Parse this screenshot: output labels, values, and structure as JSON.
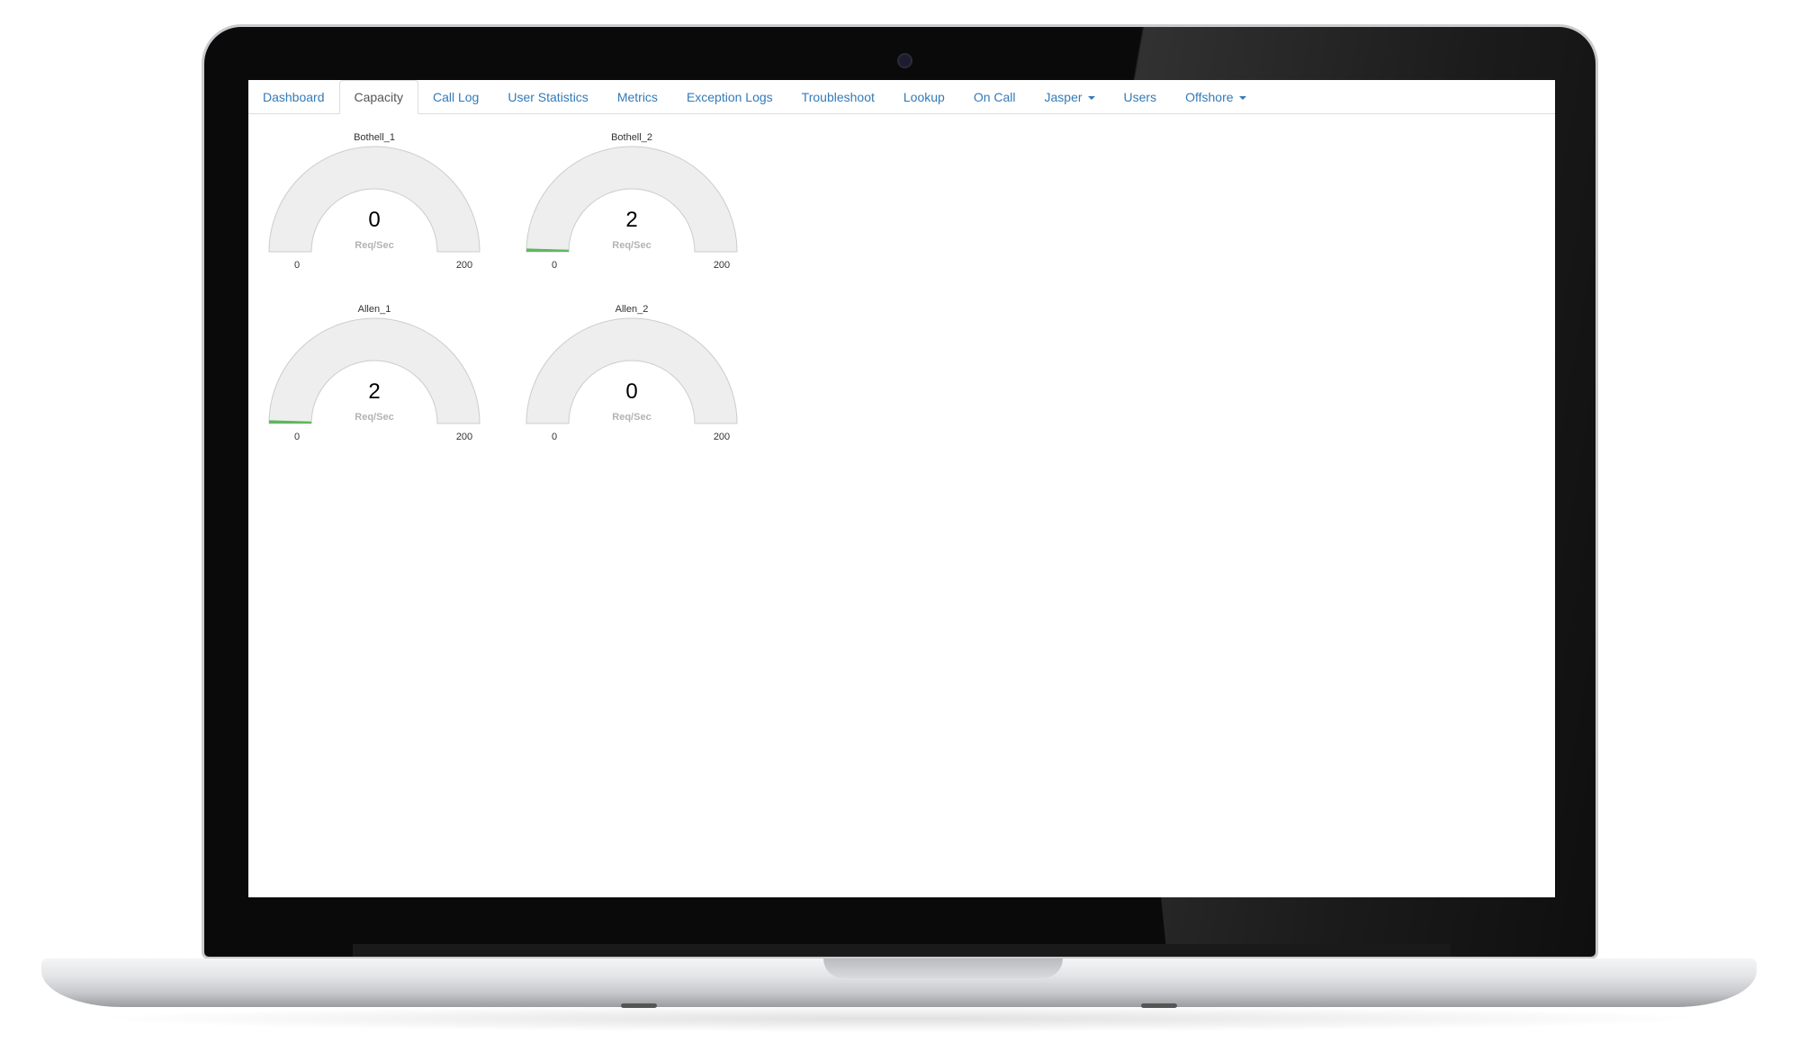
{
  "nav": {
    "tabs": [
      {
        "label": "Dashboard",
        "active": false
      },
      {
        "label": "Capacity",
        "active": true
      },
      {
        "label": "Call Log",
        "active": false
      },
      {
        "label": "User Statistics",
        "active": false
      },
      {
        "label": "Metrics",
        "active": false
      },
      {
        "label": "Exception Logs",
        "active": false
      },
      {
        "label": "Troubleshoot",
        "active": false
      },
      {
        "label": "Lookup",
        "active": false
      },
      {
        "label": "On Call",
        "active": false
      },
      {
        "label": "Jasper",
        "active": false,
        "dropdown": true
      },
      {
        "label": "Users",
        "active": false
      },
      {
        "label": "Offshore",
        "active": false,
        "dropdown": true
      }
    ]
  },
  "gauges": [
    {
      "title": "Bothell_1",
      "value": 0,
      "unit": "Req/Sec",
      "min": 0,
      "max": 200
    },
    {
      "title": "Bothell_2",
      "value": 2,
      "unit": "Req/Sec",
      "min": 0,
      "max": 200
    },
    {
      "title": "Allen_1",
      "value": 2,
      "unit": "Req/Sec",
      "min": 0,
      "max": 200
    },
    {
      "title": "Allen_2",
      "value": 0,
      "unit": "Req/Sec",
      "min": 0,
      "max": 200
    }
  ],
  "colors": {
    "gauge_track": "#eeeeee",
    "gauge_border": "#cccccc",
    "gauge_fill": "#5cb85c",
    "link": "#337ab7"
  }
}
